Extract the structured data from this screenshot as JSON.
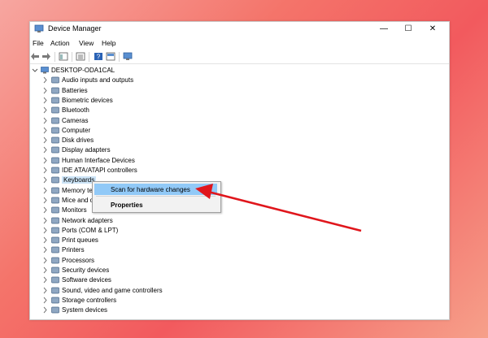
{
  "window": {
    "title": "Device Manager",
    "minimize": "—",
    "maximize": "☐",
    "close": "✕"
  },
  "menu": [
    "File",
    "Action",
    "View",
    "Help"
  ],
  "tree": {
    "root": "DESKTOP-ODA1CAL",
    "items": [
      {
        "label": "Audio inputs and outputs",
        "icon": "speaker-icon"
      },
      {
        "label": "Batteries",
        "icon": "battery-icon"
      },
      {
        "label": "Biometric devices",
        "icon": "fingerprint-icon"
      },
      {
        "label": "Bluetooth",
        "icon": "bluetooth-icon"
      },
      {
        "label": "Cameras",
        "icon": "camera-icon"
      },
      {
        "label": "Computer",
        "icon": "monitor-icon"
      },
      {
        "label": "Disk drives",
        "icon": "disk-icon"
      },
      {
        "label": "Display adapters",
        "icon": "display-adapter-icon"
      },
      {
        "label": "Human Interface Devices",
        "icon": "hid-icon"
      },
      {
        "label": "IDE ATA/ATAPI controllers",
        "icon": "ide-controller-icon"
      },
      {
        "label": "Keyboards",
        "icon": "keyboard-icon"
      },
      {
        "label": "Memory te",
        "icon": "memory-icon"
      },
      {
        "label": "Mice and o",
        "icon": "mouse-icon"
      },
      {
        "label": "Monitors",
        "icon": "monitor-icon"
      },
      {
        "label": "Network adapters",
        "icon": "network-icon"
      },
      {
        "label": "Ports (COM & LPT)",
        "icon": "port-icon"
      },
      {
        "label": "Print queues",
        "icon": "printer-icon"
      },
      {
        "label": "Printers",
        "icon": "printer-icon"
      },
      {
        "label": "Processors",
        "icon": "processor-icon"
      },
      {
        "label": "Security devices",
        "icon": "security-icon"
      },
      {
        "label": "Software devices",
        "icon": "software-icon"
      },
      {
        "label": "Sound, video and game controllers",
        "icon": "speaker-icon"
      },
      {
        "label": "Storage controllers",
        "icon": "storage-icon"
      },
      {
        "label": "System devices",
        "icon": "system-icon"
      }
    ]
  },
  "context_menu": {
    "scan": "Scan for hardware changes",
    "properties": "Properties"
  },
  "colors": {
    "selection": "#cce4f7",
    "highlight": "#91c9f7",
    "arrow": "#e0161c"
  }
}
